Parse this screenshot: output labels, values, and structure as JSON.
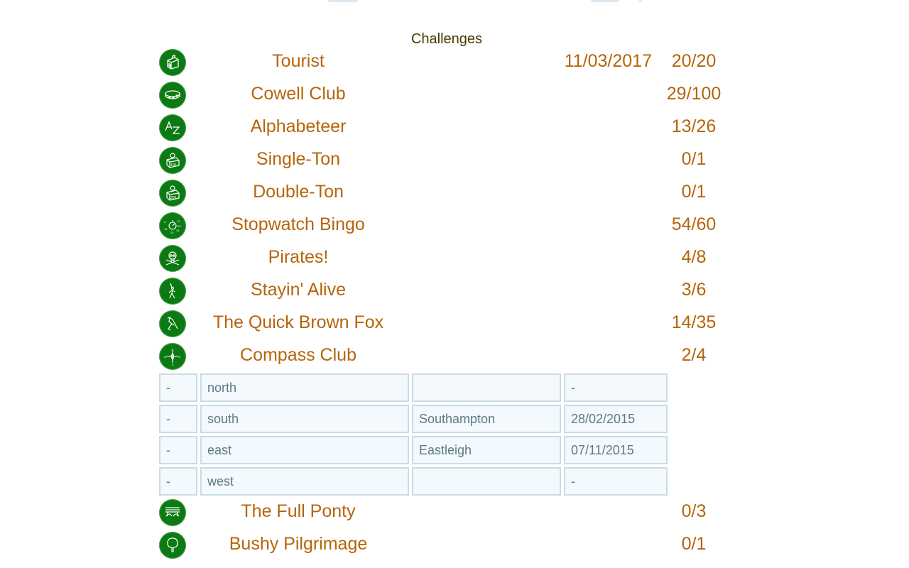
{
  "page": {
    "title": "Challenges"
  },
  "colors": {
    "accent_text": "#b5650b",
    "icon_background": "#0b7a12",
    "subtable_background": "#f3f9fc",
    "subtable_border": "#c8dde6",
    "subtable_text": "#5e7a85"
  },
  "challenges": [
    {
      "icon": "tourist-suitcase-icon",
      "name": "Tourist",
      "date": "11/03/2017",
      "count": "20/20"
    },
    {
      "icon": "cowell-club-icon",
      "name": "Cowell Club",
      "date": "",
      "count": "29/100"
    },
    {
      "icon": "alphabet-az-icon",
      "name": "Alphabeteer",
      "date": "",
      "count": "13/26"
    },
    {
      "icon": "weight-100-icon",
      "name": "Single-Ton",
      "date": "",
      "count": "0/1"
    },
    {
      "icon": "weight-200-icon",
      "name": "Double-Ton",
      "date": "",
      "count": "0/1"
    },
    {
      "icon": "stopwatch-icon",
      "name": "Stopwatch Bingo",
      "date": "",
      "count": "54/60"
    },
    {
      "icon": "skull-crossbones-icon",
      "name": "Pirates!",
      "date": "",
      "count": "4/8"
    },
    {
      "icon": "dancer-icon",
      "name": "Stayin' Alive",
      "date": "",
      "count": "3/6"
    },
    {
      "icon": "fox-icon",
      "name": "The Quick Brown Fox",
      "date": "",
      "count": "14/35"
    },
    {
      "icon": "compass-icon",
      "name": "Compass Club",
      "date": "",
      "count": "2/4"
    }
  ],
  "compass_details": [
    {
      "status": "-",
      "direction": "north",
      "event": "",
      "date": "-"
    },
    {
      "status": "-",
      "direction": "south",
      "event": "Southampton",
      "date": "28/02/2015"
    },
    {
      "status": "-",
      "direction": "east",
      "event": "Eastleigh",
      "date": "07/11/2015"
    },
    {
      "status": "-",
      "direction": "west",
      "event": "",
      "date": "-"
    }
  ],
  "challenges_after": [
    {
      "icon": "bridge-icon",
      "name": "The Full Ponty",
      "date": "",
      "count": "0/3"
    },
    {
      "icon": "tree-icon",
      "name": "Bushy Pilgrimage",
      "date": "",
      "count": "0/1"
    }
  ]
}
